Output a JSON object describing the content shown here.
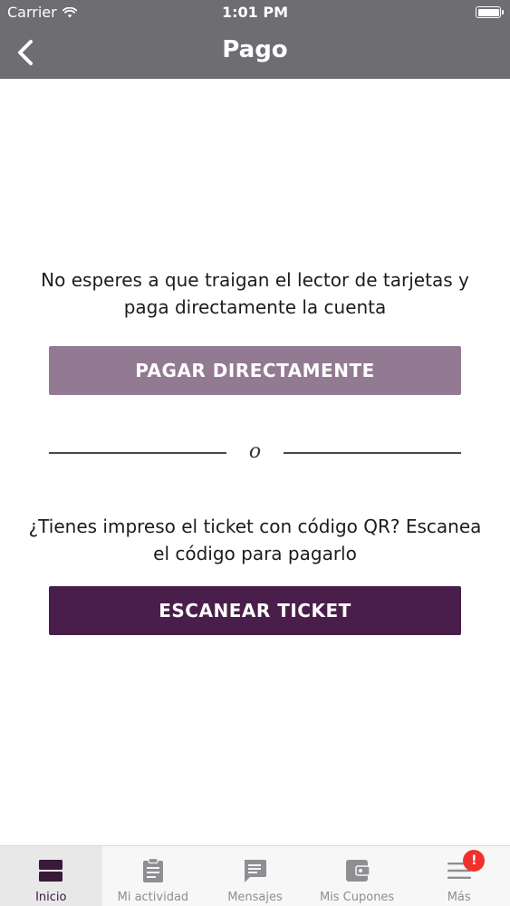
{
  "status_bar": {
    "carrier": "Carrier",
    "time": "1:01 PM"
  },
  "nav": {
    "title": "Pago"
  },
  "main": {
    "pay_prompt": "No esperes a que traigan el lector de tarjetas y paga directamente la cuenta",
    "pay_button_label": "PAGAR DIRECTAMENTE",
    "divider_text": "o",
    "scan_prompt": "¿Tienes impreso el ticket con código QR? Escanea el código para pagarlo",
    "scan_button_label": "ESCANEAR TICKET"
  },
  "tabbar": {
    "items": [
      {
        "label": "Inicio",
        "icon": "home-icon",
        "active": true
      },
      {
        "label": "Mi actividad",
        "icon": "clipboard-icon",
        "active": false
      },
      {
        "label": "Mensajes",
        "icon": "message-icon",
        "active": false
      },
      {
        "label": "Mis Cupones",
        "icon": "wallet-icon",
        "active": false
      },
      {
        "label": "Más",
        "icon": "menu-icon",
        "active": false,
        "badge": "!"
      }
    ]
  },
  "colors": {
    "nav_background": "#6d6d72",
    "pay_button": "#937a93",
    "scan_button": "#4a1e4a",
    "badge": "#f0322d"
  }
}
